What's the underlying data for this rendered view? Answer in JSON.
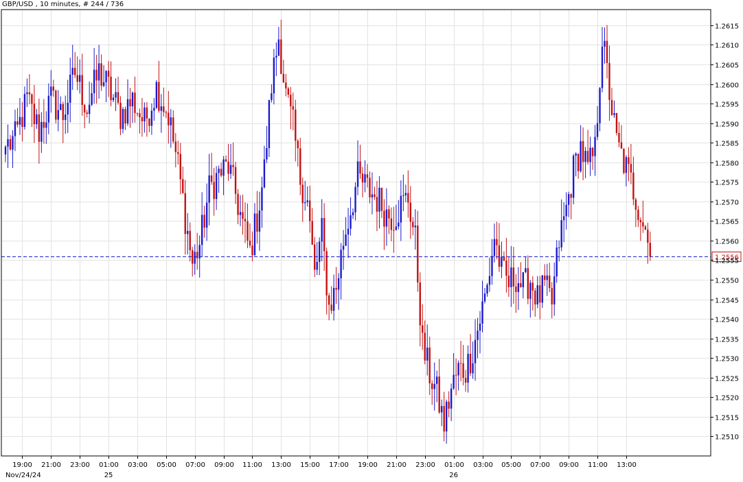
{
  "header": {
    "symbol": "GBP/USD",
    "timeframe": "10 minutes",
    "counter": "# 244 / 736"
  },
  "colors": {
    "up": "#1a1acc",
    "down": "#c41111",
    "grid": "#e2e2e2",
    "current_line": "#1a1acc"
  },
  "chart_data": {
    "type": "candlestick",
    "title": "",
    "xlabel": "",
    "ylabel": "",
    "ylim": [
      1.2505,
      1.2619
    ],
    "yticks": [
      1.251,
      1.2515,
      1.252,
      1.2525,
      1.253,
      1.2535,
      1.254,
      1.2545,
      1.255,
      1.2555,
      1.256,
      1.2565,
      1.257,
      1.2575,
      1.258,
      1.2585,
      1.259,
      1.2595,
      1.26,
      1.2605,
      1.261,
      1.2615
    ],
    "current_price": 1.2556,
    "current_price_label": "1.2556",
    "x_time_labels": [
      "19:00",
      "21:00",
      "23:00",
      "01:00",
      "03:00",
      "05:00",
      "07:00",
      "09:00",
      "11:00",
      "13:00",
      "15:00",
      "17:00",
      "19:00",
      "21:00",
      "23:00",
      "01:00",
      "03:00",
      "05:00",
      "07:00",
      "09:00",
      "11:00",
      "13:00"
    ],
    "x_date_labels": [
      {
        "label": "Nov/24/24",
        "at": "18:30"
      },
      {
        "label": "25",
        "at": "01:00"
      },
      {
        "label": "26",
        "at": "01:00"
      }
    ],
    "anchors": [
      [
        0,
        1.2584
      ],
      [
        4,
        1.2586
      ],
      [
        9,
        1.2596
      ],
      [
        14,
        1.2588
      ],
      [
        19,
        1.2596
      ],
      [
        24,
        1.2592
      ],
      [
        29,
        1.2603
      ],
      [
        34,
        1.2594
      ],
      [
        39,
        1.2603
      ],
      [
        43,
        1.2599
      ],
      [
        48,
        1.2592
      ],
      [
        53,
        1.2596
      ],
      [
        58,
        1.259
      ],
      [
        63,
        1.2599
      ],
      [
        68,
        1.2592
      ],
      [
        72,
        1.2579
      ],
      [
        75,
        1.2566
      ],
      [
        78,
        1.2554
      ],
      [
        81,
        1.2559
      ],
      [
        85,
        1.2573
      ],
      [
        89,
        1.2577
      ],
      [
        93,
        1.2579
      ],
      [
        96,
        1.2572
      ],
      [
        99,
        1.2564
      ],
      [
        102,
        1.2557
      ],
      [
        105,
        1.2566
      ],
      [
        108,
        1.2578
      ],
      [
        111,
        1.26
      ],
      [
        114,
        1.2612
      ],
      [
        117,
        1.2597
      ],
      [
        120,
        1.2589
      ],
      [
        123,
        1.2576
      ],
      [
        126,
        1.257
      ],
      [
        129,
        1.2551
      ],
      [
        132,
        1.2562
      ],
      [
        135,
        1.2543
      ],
      [
        138,
        1.2548
      ],
      [
        141,
        1.256
      ],
      [
        144,
        1.2568
      ],
      [
        147,
        1.2576
      ],
      [
        150,
        1.2574
      ],
      [
        153,
        1.2572
      ],
      [
        156,
        1.257
      ],
      [
        159,
        1.2567
      ],
      [
        162,
        1.2566
      ],
      [
        165,
        1.2569
      ],
      [
        168,
        1.2571
      ],
      [
        171,
        1.256
      ],
      [
        174,
        1.2533
      ],
      [
        177,
        1.2526
      ],
      [
        180,
        1.2521
      ],
      [
        183,
        1.2513
      ],
      [
        186,
        1.2522
      ],
      [
        189,
        1.2527
      ],
      [
        192,
        1.2527
      ],
      [
        195,
        1.2532
      ],
      [
        198,
        1.254
      ],
      [
        201,
        1.2548
      ],
      [
        204,
        1.2561
      ],
      [
        207,
        1.2552
      ],
      [
        210,
        1.2549
      ],
      [
        213,
        1.2551
      ],
      [
        216,
        1.2548
      ],
      [
        219,
        1.255
      ],
      [
        222,
        1.2545
      ],
      [
        225,
        1.2548
      ],
      [
        228,
        1.2544
      ],
      [
        231,
        1.256
      ],
      [
        234,
        1.2568
      ],
      [
        237,
        1.2578
      ],
      [
        240,
        1.2584
      ],
      [
        243,
        1.2578
      ],
      [
        246,
        1.2583
      ],
      [
        249,
        1.2612
      ],
      [
        252,
        1.2598
      ],
      [
        255,
        1.2585
      ],
      [
        258,
        1.258
      ],
      [
        261,
        1.2575
      ],
      [
        264,
        1.2569
      ],
      [
        267,
        1.2563
      ],
      [
        269,
        1.2556
      ]
    ]
  }
}
